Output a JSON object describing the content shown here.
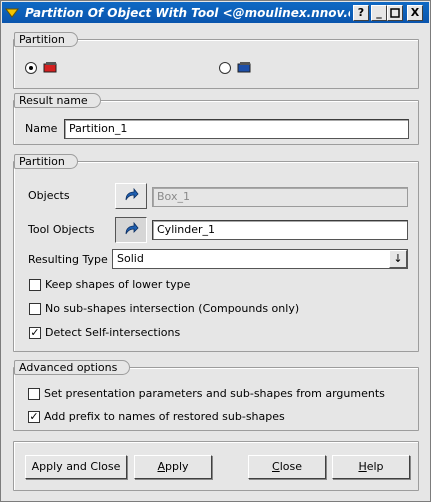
{
  "window": {
    "title": "Partition Of Object With Tool <@moulinex.nnov.openca",
    "help_btn": "?",
    "min_btn": "_",
    "max_btn": "□",
    "close_btn": "X"
  },
  "partition_type": {
    "group_title": "Partition",
    "options": [
      {
        "icon": "partition-solid-icon",
        "selected": true
      },
      {
        "icon": "partition-plane-icon",
        "selected": false
      }
    ]
  },
  "result": {
    "group_title": "Result name",
    "name_label": "Name",
    "name_value": "Partition_1"
  },
  "partition": {
    "group_title": "Partition",
    "objects_label": "Objects",
    "objects_value": "Box_1",
    "tool_objects_label": "Tool Objects",
    "tool_objects_value": "Cylinder_1",
    "resulting_type_label": "Resulting Type",
    "resulting_type_value": "Solid",
    "keep_shapes_label": "Keep shapes of lower type",
    "keep_shapes_checked": false,
    "no_subshapes_label": "No sub-shapes intersection (Compounds only)",
    "no_subshapes_checked": false,
    "detect_self_label": "Detect Self-intersections",
    "detect_self_checked": true
  },
  "advanced": {
    "group_title": "Advanced options",
    "set_presentation_label": "Set presentation parameters and sub-shapes from arguments",
    "set_presentation_checked": false,
    "add_prefix_label": "Add prefix to names of restored sub-shapes",
    "add_prefix_checked": true
  },
  "buttons": {
    "apply_close_pre": "Apply and Close",
    "apply_pre": "",
    "apply_ul": "A",
    "apply_post": "pply",
    "close_ul": "C",
    "close_post": "lose",
    "help_ul": "H",
    "help_post": "elp"
  },
  "colors": {
    "titlebar": "#0a5fb8",
    "window_bg": "#e6e6e6"
  }
}
